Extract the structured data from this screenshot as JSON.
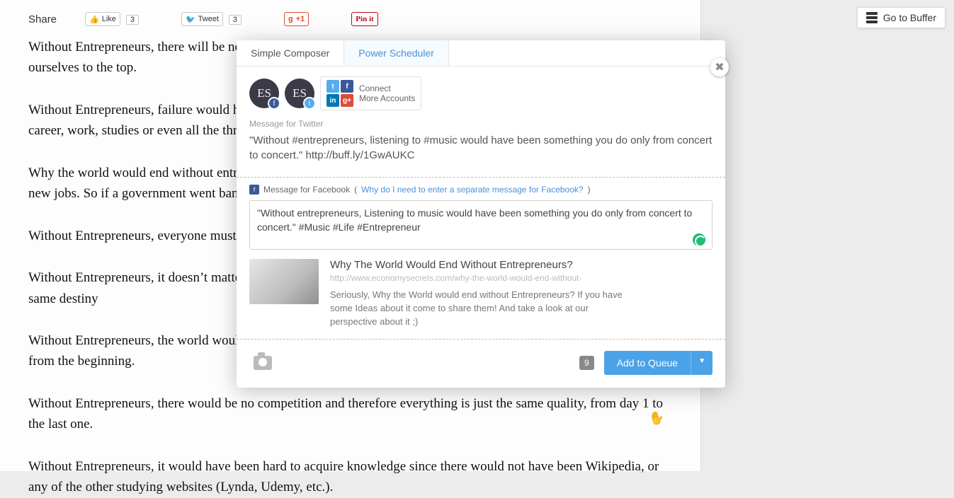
{
  "share": {
    "label": "Share",
    "fb_like": "Like",
    "fb_count": "3",
    "tweet": "Tweet",
    "tweet_count": "3",
    "gplus": "+1",
    "pinit": "Pin it"
  },
  "article": {
    "p0": "Without Entrepreneurs, there will be no risk takers and no success stories which  inspire us to always keep pushing ourselves to the top.",
    "p1": "Without Entrepreneurs, failure would have been something tragic and pathetic. Failing would definitely ruin your career, work, studies or even all the three.",
    "p2": "Why the world would end without entrepreneurs? Simply because there would be no new flourishing Businesses, so no new jobs. So if a government went bankrupt, the ones working for it are just doomed.",
    "p3": "Without Entrepreneurs, everyone must pursue a uniform path of life and it’s just boring like that.",
    "p4": "Without Entrepreneurs, it doesn’t matter if you were different or unique, we all share the same boring life, and the same destiny",
    "p5": "Without Entrepreneurs, the world wouldn’t have progressed, there would be no knew technologies, we barely evolved  from the beginning.",
    "p6": "Without Entrepreneurs, there would be no competition and therefore everything is just the same quality, from day 1 to the last one.",
    "p7": "Without Entrepreneurs, it would have been hard to acquire knowledge since there would not have been Wikipedia, or any of the other studying websites (Lynda, Udemy, etc.)."
  },
  "goto_buffer": "Go to Buffer",
  "modal": {
    "tabs": {
      "simple": "Simple Composer",
      "power": "Power Scheduler"
    },
    "avatar_initials": "ES",
    "connect_line1": "Connect",
    "connect_line2": "More Accounts",
    "twitter_label": "Message for Twitter",
    "twitter_text": "\"Without #entrepreneurs, listening to #music would have been something you do only from concert to concert.\" http://buff.ly/1GwAUKC",
    "fb_label": "Message for Facebook",
    "fb_why_prefix": "(",
    "fb_why": "Why do I need to enter a separate message for Facebook?",
    "fb_why_suffix": ")",
    "fb_text": "\"Without entrepreneurs, Listening to music would have been something you do only from concert to concert.\" #Music #Life #Entrepreneur ",
    "preview": {
      "title": "Why The World Would End Without Entrepreneurs?",
      "url": "http://www.economysecrets.com/why-the-world-would-end-without-",
      "desc": "Seriously, Why the World would end without Entrepreneurs? If you have some Ideas about it come to share them! And take a look at our perspective about it ;)"
    },
    "count": "9",
    "add_to_queue": "Add to Queue"
  }
}
